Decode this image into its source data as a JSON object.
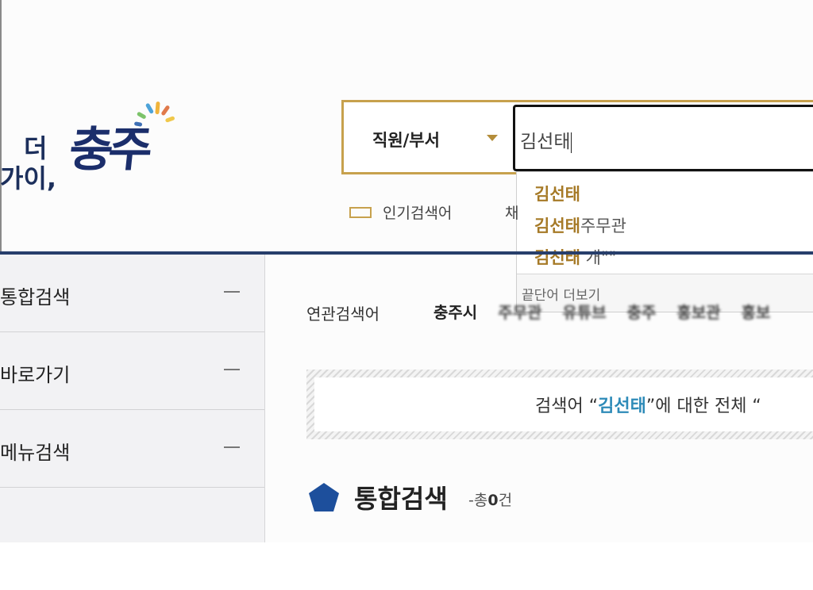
{
  "logo": {
    "line1": "더",
    "line2": "가이,",
    "brand": "충주"
  },
  "search": {
    "category": "직원/부서",
    "query": "김선태"
  },
  "autocomplete": {
    "items": [
      {
        "highlight": "김선태",
        "rest": ""
      },
      {
        "highlight": "김선태",
        "rest": "주무관"
      },
      {
        "highlight": "김선태",
        "rest": " 개\"\""
      }
    ],
    "footer": "끝단어 더보기"
  },
  "popular": {
    "label": "인기검색어",
    "extra": "채"
  },
  "sidebar": {
    "items": [
      {
        "label": "통합검색"
      },
      {
        "label": "바로가기"
      },
      {
        "label": "메뉴검색"
      }
    ]
  },
  "related": {
    "label": "연관검색어",
    "terms": [
      "충주시",
      "주무관",
      "유튜브",
      "충주",
      "홍보관",
      "홍보"
    ]
  },
  "result_banner": {
    "prefix": "검색어 “",
    "query": "김선태",
    "suffix": "”에 대한 전체 “"
  },
  "section": {
    "title": "통합검색",
    "count_prefix": "-총",
    "count": "0",
    "count_suffix": "건"
  },
  "colors": {
    "accent_gold": "#c7a14d",
    "navy": "#273e6b",
    "query_blue": "#2e8bb8"
  }
}
